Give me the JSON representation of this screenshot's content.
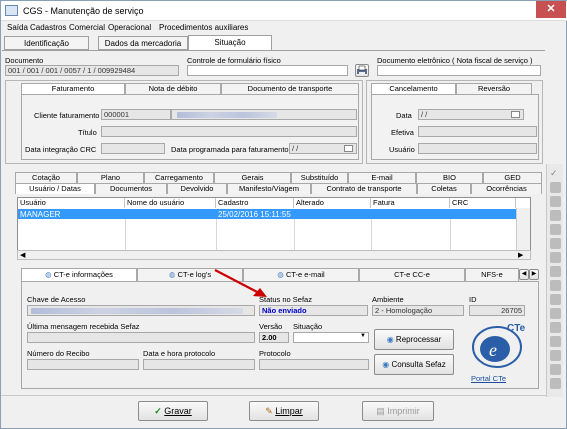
{
  "window": {
    "title": "CGS - Manutenção de serviço",
    "close_label": "✕"
  },
  "menu": [
    "Saída",
    "Cadastros",
    "Comercial",
    "Operacional",
    "Procedimentos auxiliares"
  ],
  "top_tabs": [
    "Identificação",
    "Dados da mercadoria",
    "Situação"
  ],
  "documento": {
    "label": "Documento",
    "value": "001 / 001 / 001 / 0057 / 1 / 009929484"
  },
  "controle": {
    "label": "Controle de formulário físico"
  },
  "doc_eletronico": {
    "label": "Documento eletrônico ( Nota fiscal de serviço )"
  },
  "faturamento_tabs": [
    "Faturamento",
    "Nota de débito",
    "Documento de transporte"
  ],
  "faturamento": {
    "cliente_label": "Cliente faturamento",
    "cliente_value": "000001",
    "titulo_label": "Título",
    "data_integracao_label": "Data integração CRC",
    "data_programada_label": "Data programada para faturamento",
    "data_programada_value": "/ /"
  },
  "cancel_tabs": [
    "Cancelamento",
    "Reversão"
  ],
  "cancelamento": {
    "data_label": "Data",
    "data_value": "/ /",
    "efetiva_label": "Efetiva",
    "usuario_label": "Usuário"
  },
  "mid_tabs_row1": [
    "Cotação",
    "Plano",
    "Carregamento",
    "Gerais",
    "Substituído",
    "E-mail",
    "BIO",
    "GED"
  ],
  "mid_tabs_row2": [
    "Usuário / Datas",
    "Documentos",
    "Devolvido",
    "Manifesto/Viagem",
    "Contrato de transporte",
    "Coletas",
    "Ocorrências"
  ],
  "grid": {
    "columns": [
      "Usuário",
      "Nome do usuário",
      "Cadastro",
      "Alterado",
      "Fatura",
      "CRC"
    ],
    "rows": [
      {
        "usuario": "MANAGER",
        "nome": "",
        "cadastro": "25/02/2016 15:11:55",
        "alterado": "",
        "fatura": "",
        "crc": ""
      }
    ]
  },
  "cte_tabs": [
    "CT-e informações",
    "CT-e log's",
    "CT-e e-mail",
    "CT-e CC-e",
    "NFS-e"
  ],
  "cte": {
    "chave_label": "Chave de Acesso",
    "status_label": "Status no Sefaz",
    "status_value": "Não enviado",
    "ambiente_label": "Ambiente",
    "ambiente_value": "2 - Homologação",
    "id_label": "ID",
    "id_value": "26705",
    "ultima_msg_label": "Última mensagem recebida Sefaz",
    "versao_label": "Versão",
    "versao_value": "2.00",
    "situacao_label": "Situação",
    "numero_recibo_label": "Número do Recibo",
    "data_protocolo_label": "Data e hora protocolo",
    "protocolo_label": "Protocolo",
    "reprocessar_label": "Reprocessar",
    "consulta_label": "Consulta Sefaz",
    "portal_label": "Portal CTe",
    "logo_text": "CTe"
  },
  "footer": {
    "gravar": "Gravar",
    "limpar": "Limpar",
    "imprimir": "Imprimir"
  },
  "colors": {
    "accent": "#0a246a",
    "selection": "#3399ff",
    "status_blue": "#0000cc",
    "arrow": "#cc0000"
  }
}
